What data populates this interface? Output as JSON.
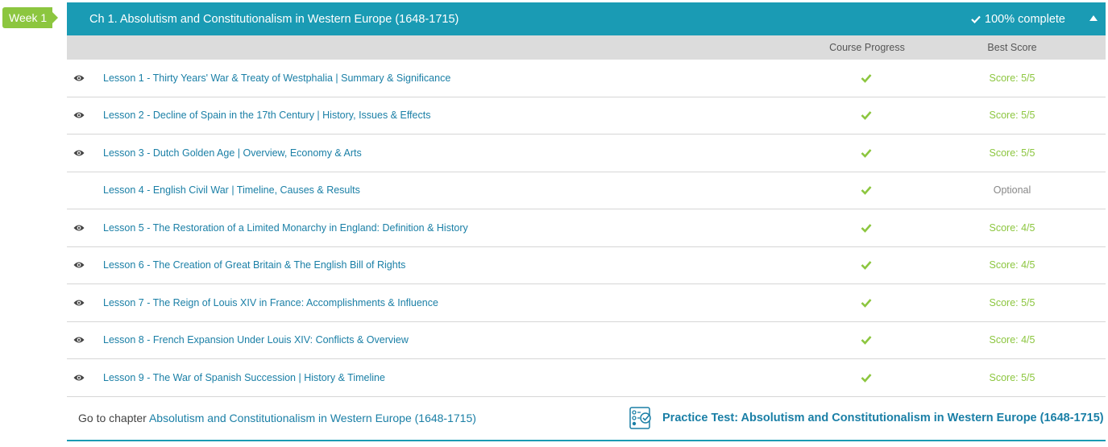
{
  "week_badge": "Week 1",
  "chapter": {
    "title": "Ch 1. Absolutism and Constitutionalism in Western Europe (1648-1715)",
    "complete_text": "100% complete"
  },
  "columns": {
    "progress": "Course Progress",
    "score": "Best Score"
  },
  "lessons": [
    {
      "title": "Lesson 1 - Thirty Years' War & Treaty of Westphalia | Summary & Significance",
      "score": "Score: 5/5",
      "viewed": true
    },
    {
      "title": "Lesson 2 - Decline of Spain in the 17th Century | History, Issues & Effects",
      "score": "Score: 5/5",
      "viewed": true
    },
    {
      "title": "Lesson 3 - Dutch Golden Age | Overview, Economy & Arts",
      "score": "Score: 5/5",
      "viewed": true
    },
    {
      "title": "Lesson 4 - English Civil War | Timeline, Causes & Results",
      "score": "Optional",
      "viewed": false
    },
    {
      "title": "Lesson 5 - The Restoration of a Limited Monarchy in England: Definition & History",
      "score": "Score: 4/5",
      "viewed": true
    },
    {
      "title": "Lesson 6 - The Creation of Great Britain & The English Bill of Rights",
      "score": "Score: 4/5",
      "viewed": true
    },
    {
      "title": "Lesson 7 - The Reign of Louis XIV in France: Accomplishments & Influence",
      "score": "Score: 5/5",
      "viewed": true
    },
    {
      "title": "Lesson 8 - French Expansion Under Louis XIV: Conflicts & Overview",
      "score": "Score: 4/5",
      "viewed": true
    },
    {
      "title": "Lesson 9 - The War of Spanish Succession | History & Timeline",
      "score": "Score: 5/5",
      "viewed": true
    }
  ],
  "footer": {
    "goto_prefix": "Go to chapter",
    "goto_link": "Absolutism and Constitutionalism in Western Europe (1648-1715)",
    "practice_link": "Practice Test: Absolutism and Constitutionalism in Western Europe (1648-1715)"
  },
  "colors": {
    "header_teal": "#1a9bb4",
    "link_blue": "#1a7fa6",
    "success_green": "#8cc63f",
    "optional_gray": "#888888"
  },
  "icons": {
    "viewed": "eye-icon",
    "progress": "checkmark-icon",
    "collapse": "caret-up-icon",
    "practice": "practice-test-icon"
  }
}
